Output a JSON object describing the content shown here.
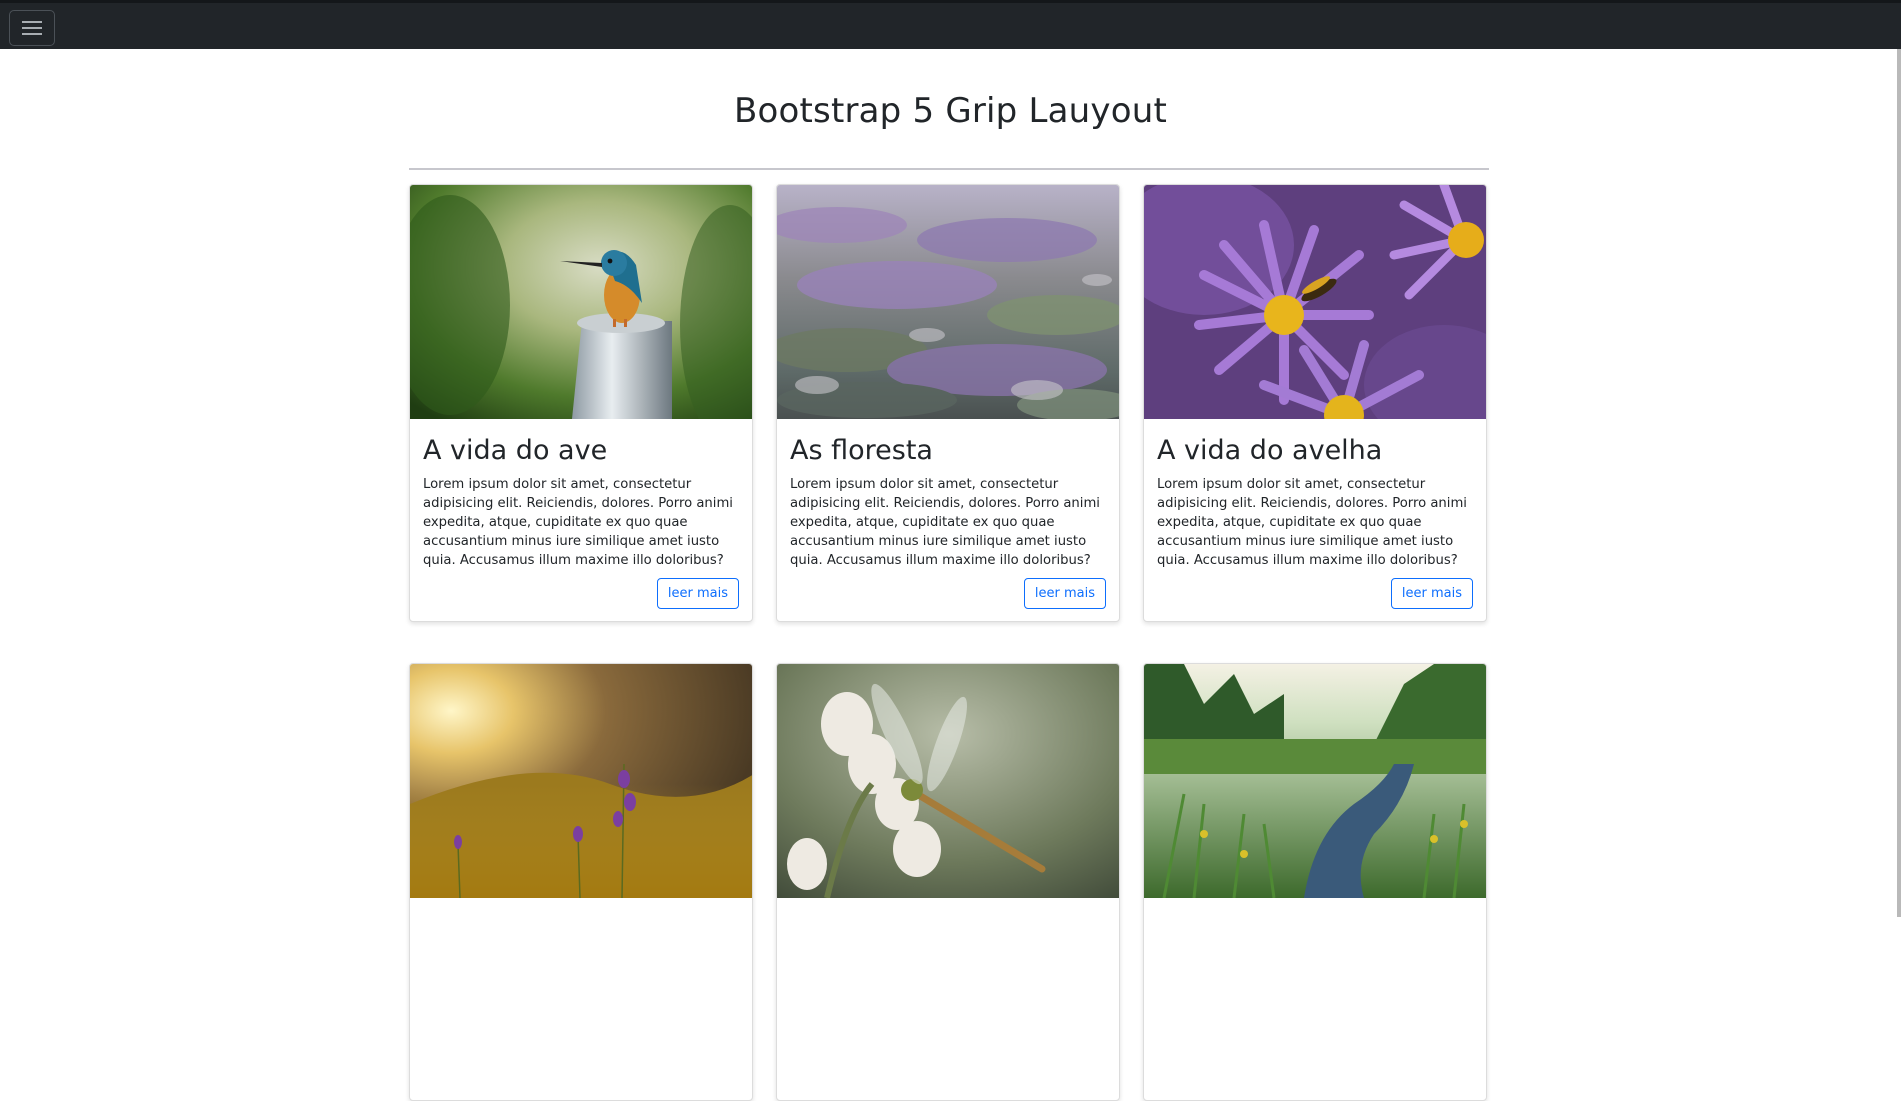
{
  "navbar": {
    "toggle_icon": "hamburger-menu-icon"
  },
  "page": {
    "title": "Bootstrap 5 Grip Lauyout"
  },
  "cards": [
    {
      "image": "kingfisher-photo",
      "title": "A vida do ave",
      "text": "Lorem ipsum dolor sit amet, consectetur adipisicing elit. Reiciendis, dolores. Porro animi expedita, atque, cupiditate ex quo quae accusantium minus iure similique amet iusto quia. Accusamus illum maxime illo doloribus?",
      "button": "leer mais"
    },
    {
      "image": "heather-field-photo",
      "title": "As floresta",
      "text": "Lorem ipsum dolor sit amet, consectetur adipisicing elit. Reiciendis, dolores. Porro animi expedita, atque, cupiditate ex quo quae accusantium minus iure similique amet iusto quia. Accusamus illum maxime illo doloribus?",
      "button": "leer mais"
    },
    {
      "image": "purple-aster-bee-photo",
      "title": "A vida do avelha",
      "text": "Lorem ipsum dolor sit amet, consectetur adipisicing elit. Reiciendis, dolores. Porro animi expedita, atque, cupiditate ex quo quae accusantium minus iure similique amet iusto quia. Accusamus illum maxime illo doloribus?",
      "button": "leer mais"
    },
    {
      "image": "sunset-meadow-photo",
      "title": "",
      "text": "",
      "button": ""
    },
    {
      "image": "dragonfly-photo",
      "title": "",
      "text": "",
      "button": ""
    },
    {
      "image": "forest-stream-photo",
      "title": "",
      "text": "",
      "button": ""
    }
  ]
}
